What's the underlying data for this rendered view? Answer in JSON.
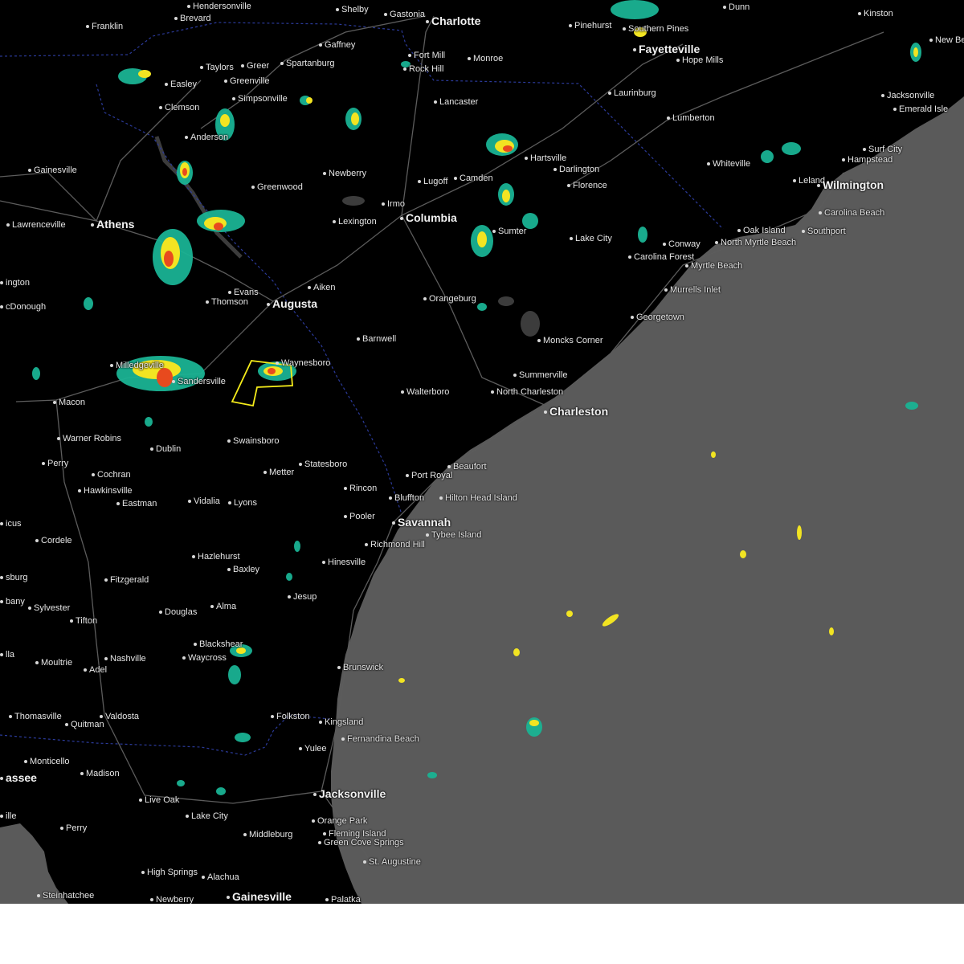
{
  "colors": {
    "land": "#000000",
    "ocean": "#5a5a5a",
    "water": "#3c3c3c",
    "road": "#5c5c5c",
    "border": "#2b3a9a",
    "radar_light": "#1ab394",
    "radar_mid": "#f2e422",
    "radar_heavy": "#e84a1e",
    "warning_polygon": "#f5ec1a",
    "label_text": "#e6e6e6",
    "footer": "#ffffff"
  },
  "cities": [
    {
      "name": "Hendersonville",
      "size": "small"
    },
    {
      "name": "Shelby",
      "size": "small"
    },
    {
      "name": "Gastonia",
      "size": "small"
    },
    {
      "name": "Charlotte",
      "size": "big"
    },
    {
      "name": "Dunn",
      "size": "small"
    },
    {
      "name": "Kinston",
      "size": "small"
    },
    {
      "name": "Brevard",
      "size": "small"
    },
    {
      "name": "Franklin",
      "size": "small"
    },
    {
      "name": "Gaffney",
      "size": "small"
    },
    {
      "name": "Fort Mill",
      "size": "small"
    },
    {
      "name": "Monroe",
      "size": "small"
    },
    {
      "name": "Rock Hill",
      "size": "small"
    },
    {
      "name": "Pinehurst",
      "size": "small"
    },
    {
      "name": "Southern Pines",
      "size": "small"
    },
    {
      "name": "Fayetteville",
      "size": "big"
    },
    {
      "name": "Hope Mills",
      "size": "small"
    },
    {
      "name": "New Bern",
      "size": "small"
    },
    {
      "name": "Taylors",
      "size": "small"
    },
    {
      "name": "Greer",
      "size": "small"
    },
    {
      "name": "Spartanburg",
      "size": "small"
    },
    {
      "name": "Easley",
      "size": "small"
    },
    {
      "name": "Greenville",
      "size": "small"
    },
    {
      "name": "Simpsonville",
      "size": "small"
    },
    {
      "name": "Clemson",
      "size": "small"
    },
    {
      "name": "Lancaster",
      "size": "small"
    },
    {
      "name": "Laurinburg",
      "size": "small"
    },
    {
      "name": "Jacksonville",
      "size": "small"
    },
    {
      "name": "Emerald Isle",
      "size": "small"
    },
    {
      "name": "Anderson",
      "size": "small"
    },
    {
      "name": "Lumberton",
      "size": "small"
    },
    {
      "name": "Hartsville",
      "size": "small"
    },
    {
      "name": "Surf City",
      "size": "small"
    },
    {
      "name": "Hampstead",
      "size": "small"
    },
    {
      "name": "Darlington",
      "size": "small"
    },
    {
      "name": "Whiteville",
      "size": "small"
    },
    {
      "name": "Gainesville",
      "size": "small"
    },
    {
      "name": "Newberry",
      "size": "small"
    },
    {
      "name": "Lugoff",
      "size": "small"
    },
    {
      "name": "Camden",
      "size": "small"
    },
    {
      "name": "Florence",
      "size": "small"
    },
    {
      "name": "Leland",
      "size": "small"
    },
    {
      "name": "Wilmington",
      "size": "big"
    },
    {
      "name": "Greenwood",
      "size": "small"
    },
    {
      "name": "Irmo",
      "size": "small"
    },
    {
      "name": "Carolina Beach",
      "size": "small"
    },
    {
      "name": "Lawrenceville",
      "size": "small"
    },
    {
      "name": "Athens",
      "size": "big"
    },
    {
      "name": "Lexington",
      "size": "small"
    },
    {
      "name": "Columbia",
      "size": "big"
    },
    {
      "name": "Oak Island",
      "size": "small"
    },
    {
      "name": "Southport",
      "size": "small"
    },
    {
      "name": "Sumter",
      "size": "small"
    },
    {
      "name": "Lake City",
      "size": "small"
    },
    {
      "name": "Conway",
      "size": "small"
    },
    {
      "name": "North Myrtle Beach",
      "size": "small"
    },
    {
      "name": "Carolina Forest",
      "size": "small"
    },
    {
      "name": "Myrtle Beach",
      "size": "small"
    },
    {
      "name": "ington",
      "size": "small"
    },
    {
      "name": "Evans",
      "size": "small"
    },
    {
      "name": "Aiken",
      "size": "small"
    },
    {
      "name": "cDonough",
      "size": "small"
    },
    {
      "name": "Thomson",
      "size": "small"
    },
    {
      "name": "Augusta",
      "size": "big"
    },
    {
      "name": "Orangeburg",
      "size": "small"
    },
    {
      "name": "Murrells Inlet",
      "size": "small"
    },
    {
      "name": "Georgetown",
      "size": "small"
    },
    {
      "name": "Barnwell",
      "size": "small"
    },
    {
      "name": "Moncks Corner",
      "size": "small"
    },
    {
      "name": "Waynesboro",
      "size": "small"
    },
    {
      "name": "Milledgeville",
      "size": "small"
    },
    {
      "name": "Sandersville",
      "size": "small"
    },
    {
      "name": "Summerville",
      "size": "small"
    },
    {
      "name": "Macon",
      "size": "small"
    },
    {
      "name": "Walterboro",
      "size": "small"
    },
    {
      "name": "North Charleston",
      "size": "small"
    },
    {
      "name": "Charleston",
      "size": "big"
    },
    {
      "name": "Warner Robins",
      "size": "small"
    },
    {
      "name": "Dublin",
      "size": "small"
    },
    {
      "name": "Swainsboro",
      "size": "small"
    },
    {
      "name": "Perry",
      "size": "small"
    },
    {
      "name": "Statesboro",
      "size": "small"
    },
    {
      "name": "Beaufort",
      "size": "small"
    },
    {
      "name": "Cochran",
      "size": "small"
    },
    {
      "name": "Metter",
      "size": "small"
    },
    {
      "name": "Port Royal",
      "size": "small"
    },
    {
      "name": "Hawkinsville",
      "size": "small"
    },
    {
      "name": "Rincon",
      "size": "small"
    },
    {
      "name": "Hilton Head Island",
      "size": "small"
    },
    {
      "name": "Eastman",
      "size": "small"
    },
    {
      "name": "Vidalia",
      "size": "small"
    },
    {
      "name": "Lyons",
      "size": "small"
    },
    {
      "name": "Bluffton",
      "size": "small"
    },
    {
      "name": "Pooler",
      "size": "small"
    },
    {
      "name": "Savannah",
      "size": "big"
    },
    {
      "name": "icus",
      "size": "small"
    },
    {
      "name": "Tybee Island",
      "size": "small"
    },
    {
      "name": "Cordele",
      "size": "small"
    },
    {
      "name": "Richmond Hill",
      "size": "small"
    },
    {
      "name": "Hazlehurst",
      "size": "small"
    },
    {
      "name": "Hinesville",
      "size": "small"
    },
    {
      "name": "Baxley",
      "size": "small"
    },
    {
      "name": "sburg",
      "size": "small"
    },
    {
      "name": "Fitzgerald",
      "size": "small"
    },
    {
      "name": "Jesup",
      "size": "small"
    },
    {
      "name": "bany",
      "size": "small"
    },
    {
      "name": "Sylvester",
      "size": "small"
    },
    {
      "name": "Alma",
      "size": "small"
    },
    {
      "name": "Douglas",
      "size": "small"
    },
    {
      "name": "Tifton",
      "size": "small"
    },
    {
      "name": "Blackshear",
      "size": "small"
    },
    {
      "name": "Waycross",
      "size": "small"
    },
    {
      "name": "lla",
      "size": "small"
    },
    {
      "name": "Moultrie",
      "size": "small"
    },
    {
      "name": "Nashville",
      "size": "small"
    },
    {
      "name": "Adel",
      "size": "small"
    },
    {
      "name": "Brunswick",
      "size": "small"
    },
    {
      "name": "Thomasville",
      "size": "small"
    },
    {
      "name": "Valdosta",
      "size": "small"
    },
    {
      "name": "Quitman",
      "size": "small"
    },
    {
      "name": "Folkston",
      "size": "small"
    },
    {
      "name": "Kingsland",
      "size": "small"
    },
    {
      "name": "Fernandina Beach",
      "size": "small"
    },
    {
      "name": "Yulee",
      "size": "small"
    },
    {
      "name": "Monticello",
      "size": "small"
    },
    {
      "name": "assee",
      "size": "big"
    },
    {
      "name": "Madison",
      "size": "small"
    },
    {
      "name": "Jacksonville",
      "size": "big"
    },
    {
      "name": "Live Oak",
      "size": "small"
    },
    {
      "name": "Lake City",
      "size": "small"
    },
    {
      "name": "ille",
      "size": "small"
    },
    {
      "name": "Orange Park",
      "size": "small"
    },
    {
      "name": "Perry",
      "size": "small"
    },
    {
      "name": "Fleming Island",
      "size": "small"
    },
    {
      "name": "Middleburg",
      "size": "small"
    },
    {
      "name": "Green Cove Springs",
      "size": "small"
    },
    {
      "name": "St. Augustine",
      "size": "small"
    },
    {
      "name": "High Springs",
      "size": "small"
    },
    {
      "name": "Alachua",
      "size": "small"
    },
    {
      "name": "Steinhatchee",
      "size": "small"
    },
    {
      "name": "Newberry",
      "size": "small"
    },
    {
      "name": "Gainesville",
      "size": "big"
    },
    {
      "name": "Palatka",
      "size": "small"
    }
  ]
}
